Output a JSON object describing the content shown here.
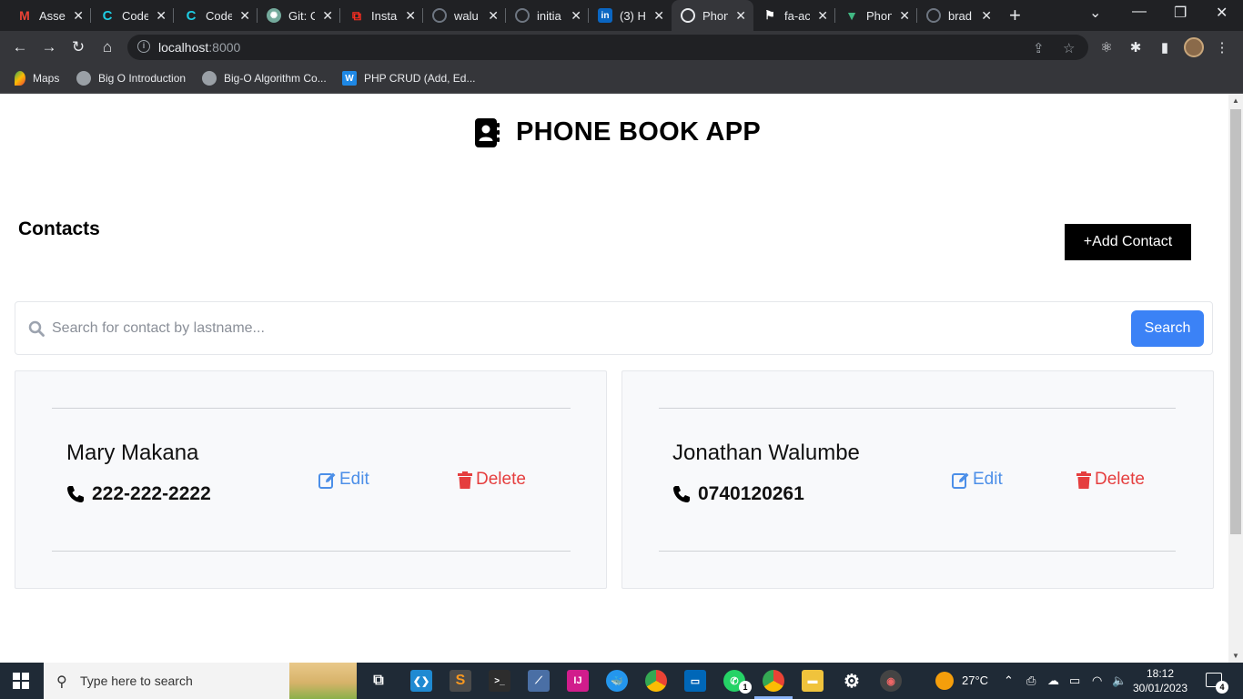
{
  "browser": {
    "tabs": [
      {
        "label": "Asse",
        "icon": "gmail-icon",
        "color": "#ea4335"
      },
      {
        "label": "Code",
        "icon": "codewars-icon",
        "color": "#1ecbe1"
      },
      {
        "label": "Code",
        "icon": "codewars-icon",
        "color": "#1ecbe1"
      },
      {
        "label": "Git: C",
        "icon": "chatgpt-icon",
        "color": "#74aa9c"
      },
      {
        "label": "Insta",
        "icon": "laravel-icon",
        "color": "#ff2d20"
      },
      {
        "label": "walu",
        "icon": "github-icon",
        "color": "#6e7681"
      },
      {
        "label": "initia",
        "icon": "github-icon",
        "color": "#6e7681"
      },
      {
        "label": "(3) H",
        "icon": "linkedin-icon",
        "color": "#0a66c2"
      },
      {
        "label": "Phon",
        "icon": "globe-icon",
        "color": "#9aa0a6"
      },
      {
        "label": "fa-ac",
        "icon": "flag-icon",
        "color": "#e8eaed"
      },
      {
        "label": "Phon",
        "icon": "vue-icon",
        "color": "#41b883"
      },
      {
        "label": "brad",
        "icon": "github-icon",
        "color": "#6e7681"
      }
    ],
    "url_host": "localhost",
    "url_port": ":8000",
    "bookmarks": [
      {
        "label": "Maps",
        "icon": "maps-icon"
      },
      {
        "label": "Big O Introduction",
        "icon": "globe-icon"
      },
      {
        "label": "Big-O Algorithm Co...",
        "icon": "globe-icon"
      },
      {
        "label": "PHP CRUD (Add, Ed...",
        "icon": "w-icon"
      }
    ]
  },
  "app": {
    "title": "PHONE BOOK APP",
    "contacts_heading": "Contacts",
    "add_button": "+Add Contact",
    "search": {
      "placeholder": "Search for contact by lastname...",
      "value": "",
      "button": "Search"
    },
    "contacts": [
      {
        "name": "Mary Makana",
        "phone": "222-222-2222",
        "edit": "Edit",
        "delete": "Delete"
      },
      {
        "name": "Jonathan Walumbe",
        "phone": "0740120261",
        "edit": "Edit",
        "delete": "Delete"
      }
    ],
    "colors": {
      "edit": "#4c8fe8",
      "delete": "#e53e3e",
      "search_button": "#3b82f6"
    }
  },
  "taskbar": {
    "search_placeholder": "Type here to search",
    "weather": "27°C",
    "time": "18:12",
    "date": "30/01/2023",
    "notifications": "4",
    "whatsapp_badge": "1"
  }
}
